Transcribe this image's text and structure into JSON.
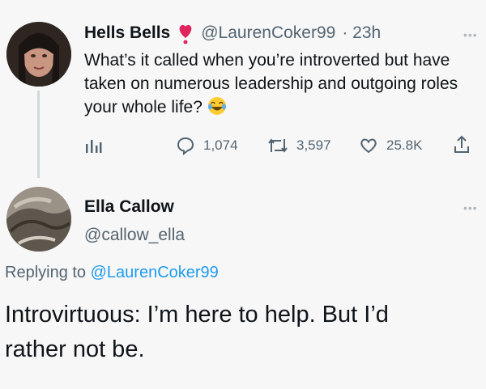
{
  "tweet": {
    "author_name": "Hells Bells",
    "author_handle": "@LaurenCoker99",
    "time": "· 23h",
    "text": "What’s it called when you’re introverted but have taken on numerous leadership and outgoing roles your whole life?",
    "emoji_icon": "laughing-crying-emoji",
    "stats": {
      "replies": "1,074",
      "retweets": "3,597",
      "likes": "25.8K"
    }
  },
  "reply": {
    "author_name": "Ella Callow",
    "author_handle": "@callow_ella",
    "replying_prefix": "Replying to",
    "replying_handle": "@LaurenCoker99",
    "text_line1": "Introvirtuous: I’m here to help. But I’d",
    "text_line2": "rather not be."
  },
  "colors": {
    "link": "#1d9bf0",
    "secondary_text": "#536471",
    "heart_badge": "#e0245e"
  }
}
